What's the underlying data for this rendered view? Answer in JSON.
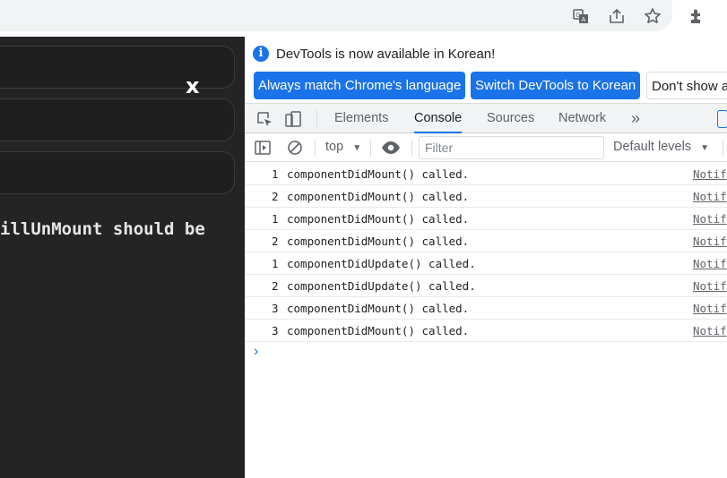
{
  "browser": {
    "icons": [
      "translate-icon",
      "share-icon",
      "star-icon",
      "extensions-icon",
      "menu-icon"
    ]
  },
  "app": {
    "close_label": "x",
    "message": "illUnMount should be"
  },
  "devtools": {
    "info": "DevTools is now available in Korean!",
    "buttons": {
      "always_match": "Always match Chrome's language",
      "switch": "Switch DevTools to Korean",
      "dont_show": "Don't show again"
    },
    "tabs": [
      "Elements",
      "Console",
      "Sources",
      "Network"
    ],
    "active_tab": "Console",
    "more_tabs": "»",
    "context": "top",
    "filter_placeholder": "Filter",
    "levels": "Default levels",
    "prompt": "›",
    "rows": [
      {
        "count": "1",
        "text": "componentDidMount() called.",
        "source": "Notif"
      },
      {
        "count": "2",
        "text": "componentDidMount() called.",
        "source": "Notif"
      },
      {
        "count": "1",
        "text": "componentDidMount() called.",
        "source": "Notif"
      },
      {
        "count": "2",
        "text": "componentDidMount() called.",
        "source": "Notif"
      },
      {
        "count": "1",
        "text": "componentDidUpdate() called.",
        "source": "Notif"
      },
      {
        "count": "2",
        "text": "componentDidUpdate() called.",
        "source": "Notif"
      },
      {
        "count": "3",
        "text": "componentDidMount() called.",
        "source": "Notif"
      },
      {
        "count": "3",
        "text": "componentDidMount() called.",
        "source": "Notif"
      }
    ]
  }
}
